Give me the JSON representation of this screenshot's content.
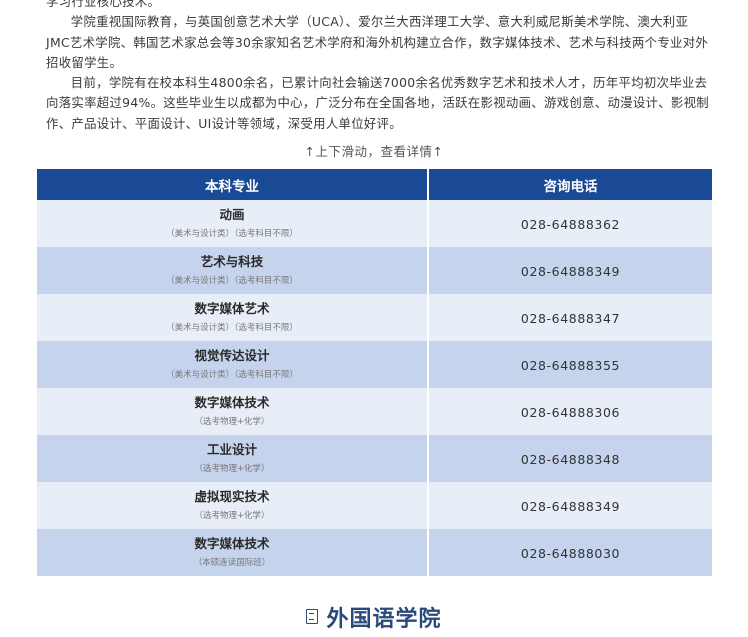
{
  "intro": {
    "para1_tail": "学习行业核心技术。",
    "para2": "学院重视国际教育，与英国创意艺术大学（UCA）、爱尔兰大西洋理工大学、意大利威尼斯美术学院、澳大利亚JMC艺术学院、韩国艺术家总会等30余家知名艺术学府和海外机构建立合作，数字媒体技术、艺术与科技两个专业对外招收留学生。",
    "para3": "目前，学院有在校本科生4800余名，已累计向社会输送7000余名优秀数字艺术和技术人才，历年平均初次毕业去向落实率超过94%。这些毕业生以成都为中心，广泛分布在全国各地，活跃在影视动画、游戏创意、动漫设计、影视制作、产品设计、平面设计、UI设计等领域，深受用人单位好评。"
  },
  "scroll_hint": "↑上下滑动，查看详情↑",
  "table": {
    "headers": [
      "本科专业",
      "咨询电话"
    ],
    "rows": [
      {
        "name": "动画",
        "note": "（美术与设计类）（选考科目不限）",
        "phone": "028-64888362"
      },
      {
        "name": "艺术与科技",
        "note": "（美术与设计类）（选考科目不限）",
        "phone": "028-64888349"
      },
      {
        "name": "数字媒体艺术",
        "note": "（美术与设计类）（选考科目不限）",
        "phone": "028-64888347"
      },
      {
        "name": "视觉传达设计",
        "note": "（美术与设计类）（选考科目不限）",
        "phone": "028-64888355"
      },
      {
        "name": "数字媒体技术",
        "note": "（选考物理+化学）",
        "phone": "028-64888306"
      },
      {
        "name": "工业设计",
        "note": "（选考物理+化学）",
        "phone": "028-64888348"
      },
      {
        "name": "虚拟现实技术",
        "note": "（选考物理+化学）",
        "phone": "028-64888349"
      },
      {
        "name": "数字媒体技术",
        "note": "（本硕连读国际班）",
        "phone": "028-64888030"
      }
    ]
  },
  "footer": {
    "title": "外国语学院",
    "icon": "book-icon"
  },
  "colors": {
    "header_bg": "#1a4a96",
    "row_light": "#e8eef8",
    "row_dark": "#c5d3ec",
    "title": "#2a4a7c"
  }
}
